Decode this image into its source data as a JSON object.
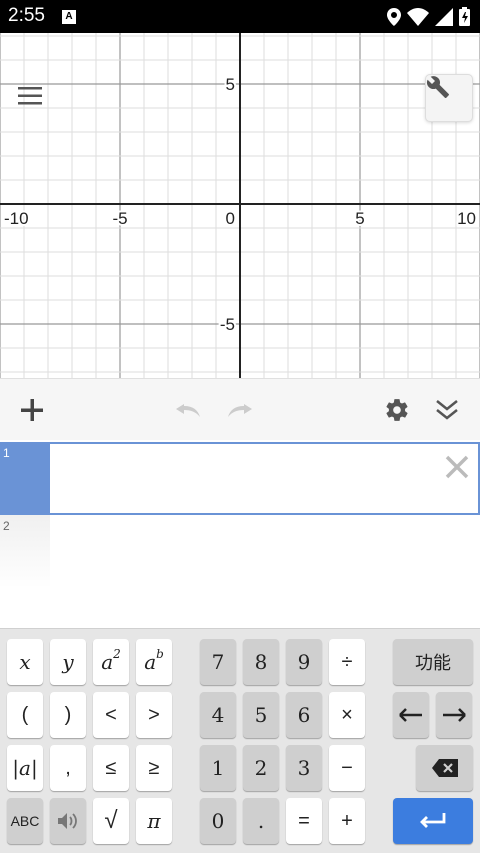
{
  "status_bar": {
    "time": "2:55",
    "notification": "A"
  },
  "graph": {
    "x_tick_labels": [
      "-10",
      "-5",
      "0",
      "5",
      "10"
    ],
    "y_tick_labels": [
      "5",
      "-5"
    ]
  },
  "toolbar": {
    "add_icon": "plus-icon",
    "undo_icon": "undo-icon",
    "redo_icon": "redo-icon",
    "settings_icon": "gear-icon",
    "collapse_icon": "double-chevron-down-icon"
  },
  "expressions": [
    {
      "number": "1",
      "value": ""
    },
    {
      "number": "2",
      "value": ""
    }
  ],
  "keypad": {
    "row1": [
      "x",
      "y",
      "a",
      "a",
      "7",
      "8",
      "9",
      "÷",
      "功能"
    ],
    "row1_sup": [
      "2",
      "b"
    ],
    "row2": [
      "(",
      ")",
      "<",
      ">",
      "4",
      "5",
      "6",
      "×"
    ],
    "row3": [
      "|a|",
      ",",
      "≤",
      "≥",
      "1",
      "2",
      "3",
      "−"
    ],
    "row4": [
      "ABC",
      "√",
      "π",
      "0",
      ".",
      "=",
      "+"
    ]
  }
}
